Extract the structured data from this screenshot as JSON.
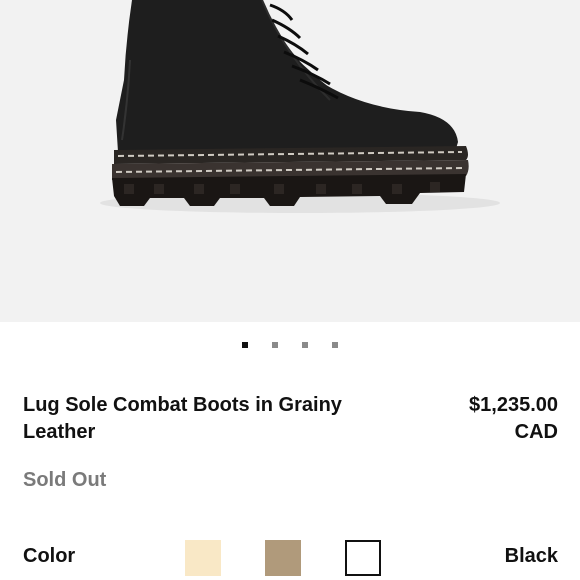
{
  "product": {
    "title": "Lug Sole Combat Boots in Grainy Leather",
    "price_amount": "$1,235.00",
    "price_currency": "CAD",
    "status": "Sold Out"
  },
  "gallery": {
    "image_count": 4,
    "active_index": 0
  },
  "color": {
    "label": "Color",
    "selected_name": "Black",
    "swatches": [
      {
        "color": "#f9e8c6",
        "selected": false
      },
      {
        "color": "#b09a7b",
        "selected": false
      },
      {
        "color": "#ffffff",
        "selected": true
      }
    ]
  }
}
